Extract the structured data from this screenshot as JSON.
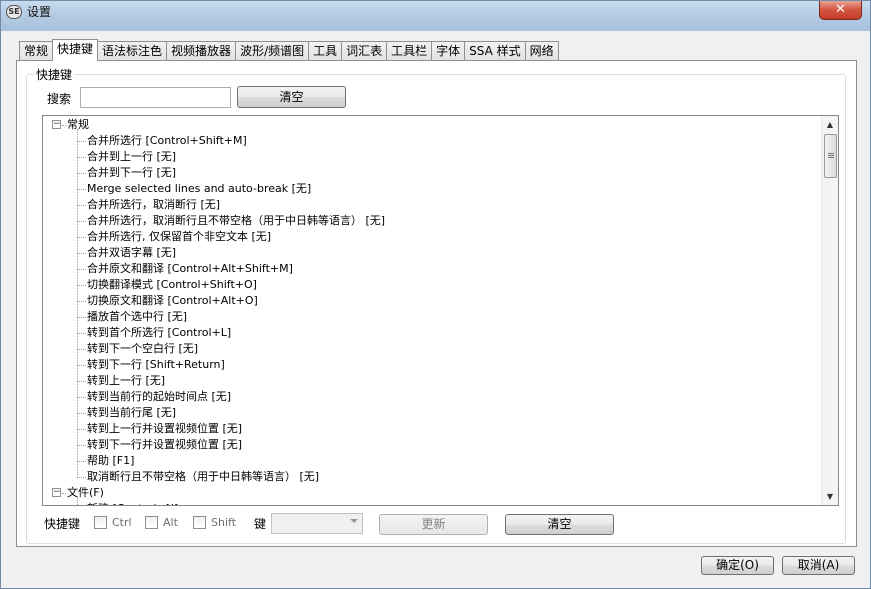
{
  "window": {
    "title": "设置",
    "app_icon_text": "SE",
    "close_glyph": "✕"
  },
  "tabs": [
    {
      "label": "常规",
      "active": false
    },
    {
      "label": "快捷键",
      "active": true
    },
    {
      "label": "语法标注色",
      "active": false
    },
    {
      "label": "视频播放器",
      "active": false
    },
    {
      "label": "波形/频谱图",
      "active": false
    },
    {
      "label": "工具",
      "active": false
    },
    {
      "label": "词汇表",
      "active": false
    },
    {
      "label": "工具栏",
      "active": false
    },
    {
      "label": "字体",
      "active": false
    },
    {
      "label": "SSA 样式",
      "active": false
    },
    {
      "label": "网络",
      "active": false
    }
  ],
  "shortcuts": {
    "group_label": "快捷键",
    "search_label": "搜索",
    "search_value": "",
    "clear_search_label": "清空",
    "tree": {
      "categories": [
        {
          "label": "常规",
          "expanded": true,
          "items": [
            "合并所选行 [Control+Shift+M]",
            "合并到上一行 [无]",
            "合并到下一行 [无]",
            "Merge selected lines and auto-break [无]",
            "合并所选行，取消断行 [无]",
            "合并所选行，取消断行且不带空格（用于中日韩等语言） [无]",
            "合并所选行, 仅保留首个非空文本 [无]",
            "合并双语字幕 [无]",
            "合并原文和翻译 [Control+Alt+Shift+M]",
            "切换翻译模式 [Control+Shift+O]",
            "切换原文和翻译 [Control+Alt+O]",
            "播放首个选中行 [无]",
            "转到首个所选行 [Control+L]",
            "转到下一个空白行 [无]",
            "转到下一行 [Shift+Return]",
            "转到上一行 [无]",
            "转到当前行的起始时间点 [无]",
            "转到当前行尾 [无]",
            "转到上一行并设置视频位置 [无]",
            "转到下一行并设置视频位置 [无]",
            "帮助 [F1]",
            "取消断行且不带空格（用于中日韩等语言） [无]"
          ]
        },
        {
          "label": "文件(F)",
          "expanded": true,
          "items": [
            "新建 [Control+N]"
          ]
        }
      ]
    },
    "editor": {
      "label": "快捷键",
      "ctrl_label": "Ctrl",
      "alt_label": "Alt",
      "shift_label": "Shift",
      "key_label": "键",
      "key_value": "",
      "update_label": "更新",
      "clear_label": "清空"
    }
  },
  "footer": {
    "ok_label": "确定(O)",
    "cancel_label": "取消(A)"
  }
}
